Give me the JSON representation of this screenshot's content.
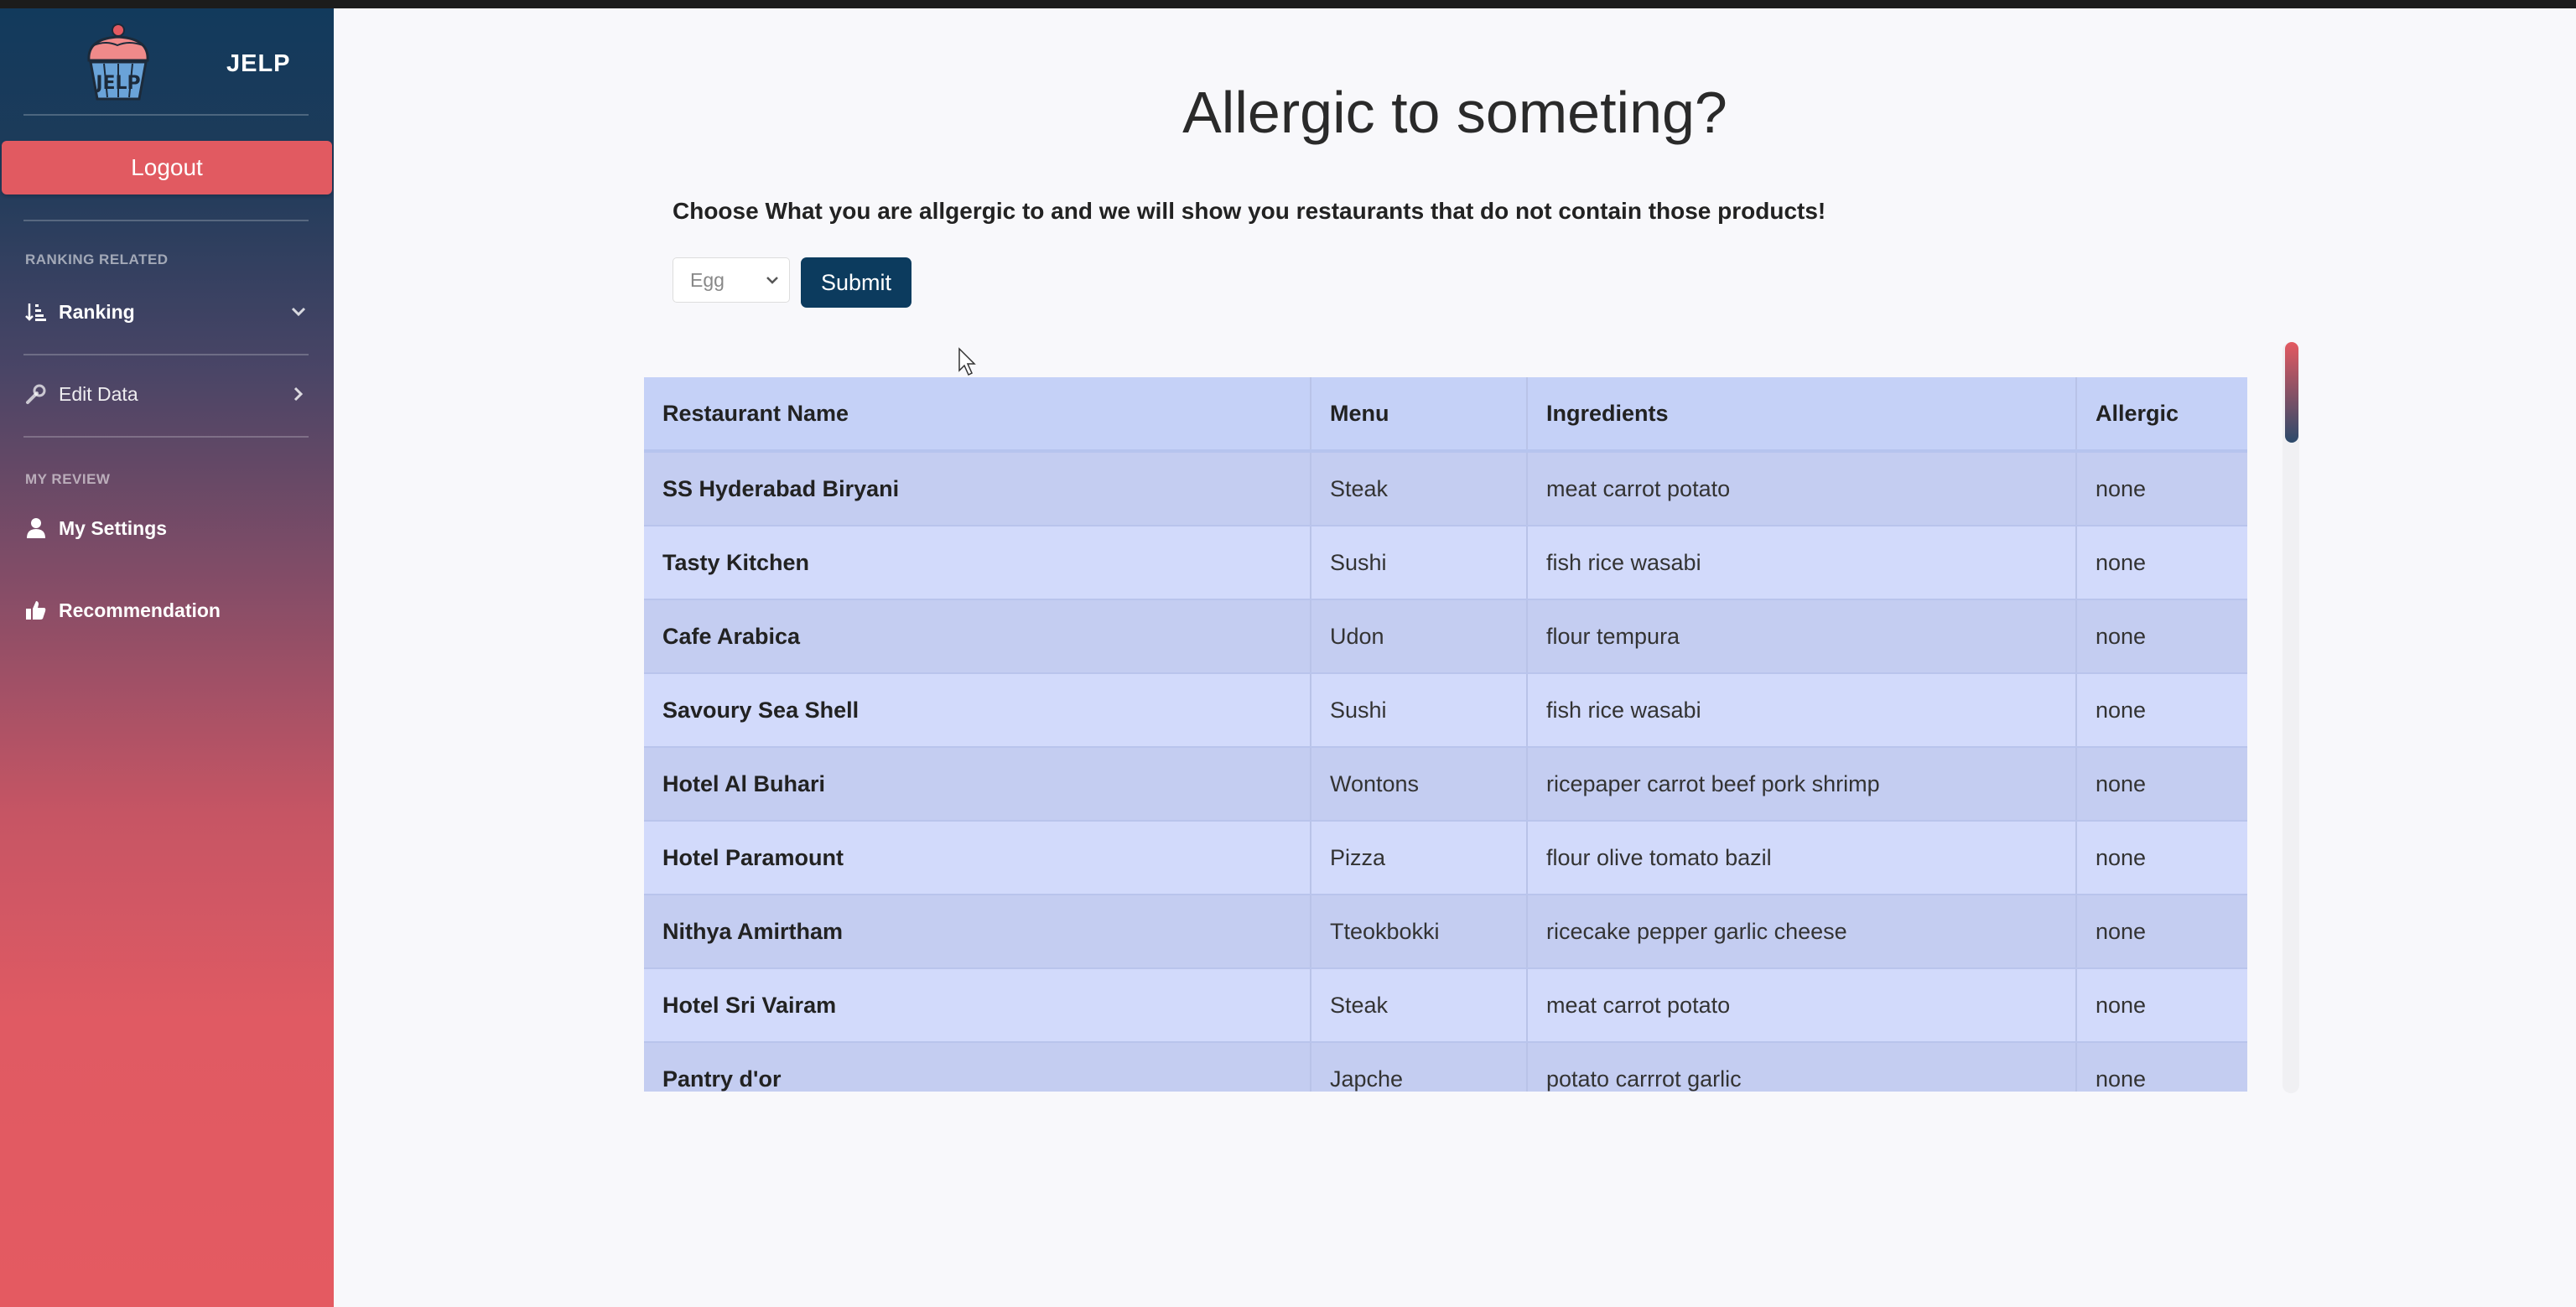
{
  "app": {
    "brand_name": "JELP",
    "logo_text": "JELP"
  },
  "sidebar": {
    "logout_label": "Logout",
    "section_ranking": "RANKING RELATED",
    "ranking_label": "Ranking",
    "edit_data_label": "Edit Data",
    "section_review": "MY REVIEW",
    "settings_label": "My Settings",
    "recommendation_label": "Recommendation"
  },
  "main": {
    "title": "Allergic to someting?",
    "subtitle": "Choose What you are allgergic to and we will show you restaurants that do not contain those products!",
    "allergen_select": {
      "selected": "Egg"
    },
    "submit_label": "Submit"
  },
  "table": {
    "headers": [
      "Restaurant Name",
      "Menu",
      "Ingredients",
      "Allergic"
    ],
    "rows": [
      {
        "name": "SS Hyderabad Biryani",
        "menu": "Steak",
        "ingredients": "meat carrot potato",
        "allergic": "none"
      },
      {
        "name": "Tasty Kitchen",
        "menu": "Sushi",
        "ingredients": "fish rice wasabi",
        "allergic": "none"
      },
      {
        "name": "Cafe Arabica",
        "menu": "Udon",
        "ingredients": "flour tempura",
        "allergic": "none"
      },
      {
        "name": "Savoury Sea Shell",
        "menu": "Sushi",
        "ingredients": "fish rice wasabi",
        "allergic": "none"
      },
      {
        "name": "Hotel Al Buhari",
        "menu": "Wontons",
        "ingredients": "ricepaper carrot beef pork shrimp",
        "allergic": "none"
      },
      {
        "name": "Hotel Paramount",
        "menu": "Pizza",
        "ingredients": "flour olive tomato bazil",
        "allergic": "none"
      },
      {
        "name": "Nithya Amirtham",
        "menu": "Tteokbokki",
        "ingredients": "ricecake pepper garlic cheese",
        "allergic": "none"
      },
      {
        "name": "Hotel Sri Vairam",
        "menu": "Steak",
        "ingredients": "meat carrot potato",
        "allergic": "none"
      },
      {
        "name": "Pantry d'or",
        "menu": "Japche",
        "ingredients": "potato carrrot garlic",
        "allergic": "none"
      }
    ]
  },
  "icons": {
    "ranking": "sort-amount-icon",
    "edit": "wrench-icon",
    "settings": "user-icon",
    "recommendation": "thumbs-up-icon",
    "chevron_down": "chevron-down-icon",
    "chevron_right": "chevron-right-icon"
  },
  "colors": {
    "sidebar_top": "#123a5c",
    "sidebar_bottom": "#e45a61",
    "logout": "#e15a61",
    "submit": "#0c3b5e",
    "table_header": "#c5d1f7",
    "row_odd": "#c4cdf1",
    "row_even": "#d2dafb"
  }
}
